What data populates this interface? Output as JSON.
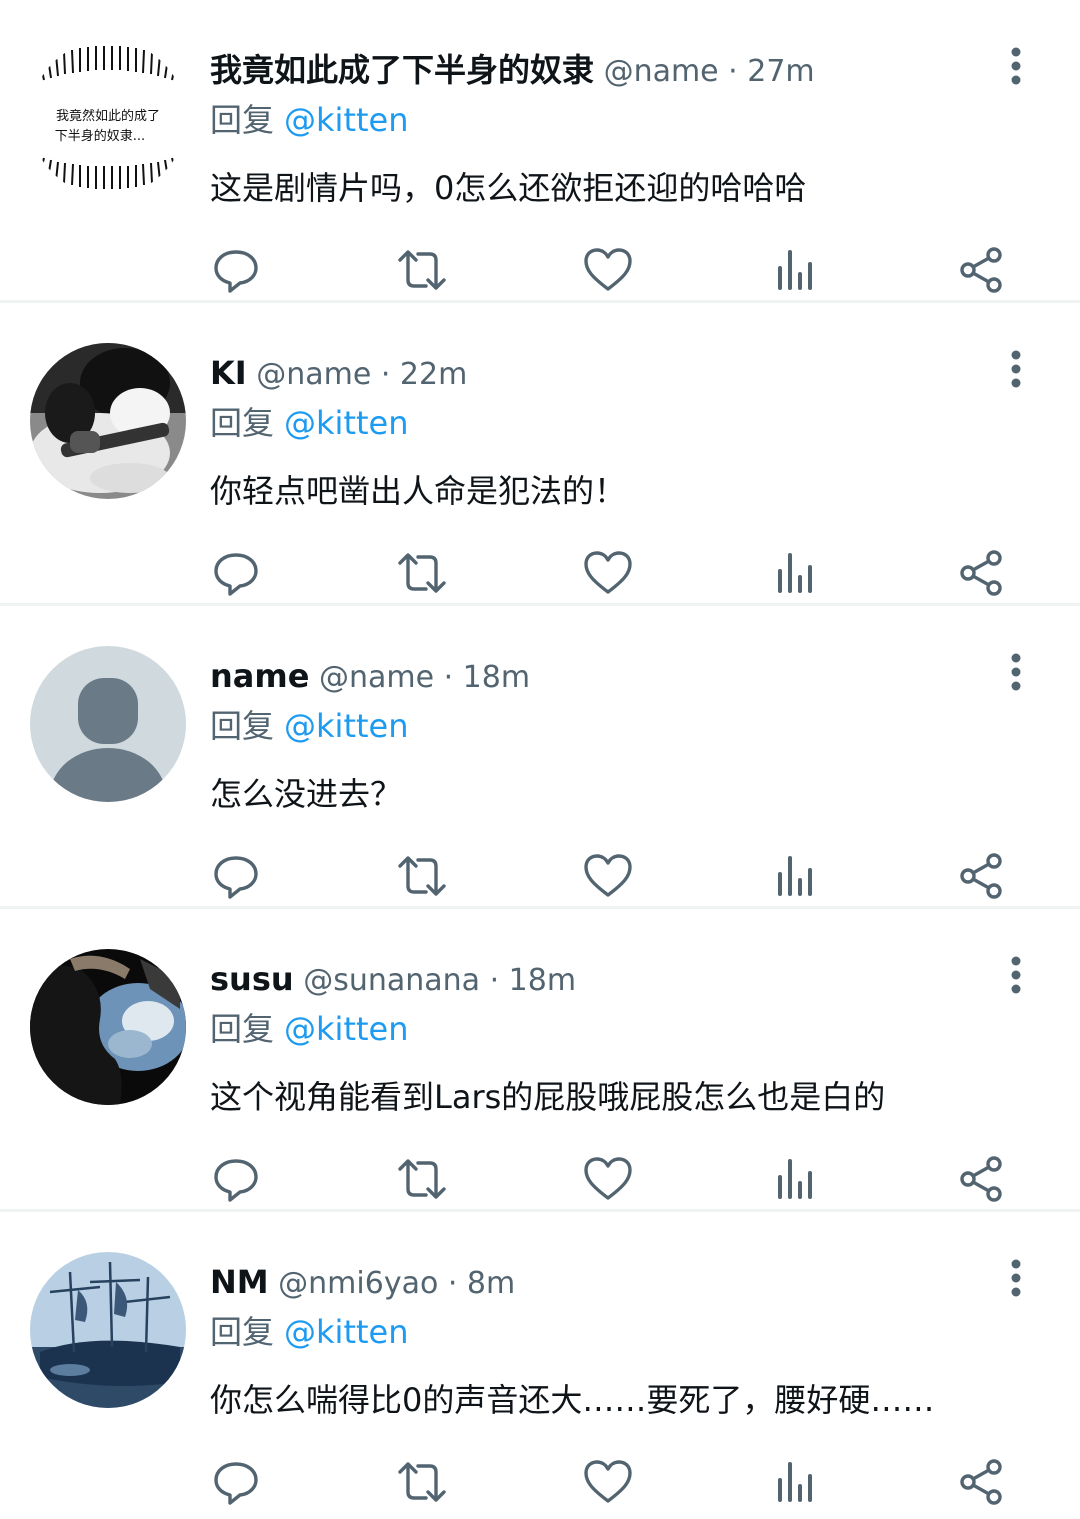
{
  "tweets": [
    {
      "name": "我竟如此成了下半身的奴隶",
      "handle_time": "@name · 27m",
      "reply_prefix": "回复",
      "reply_to": "@kitten",
      "text": "这是剧情片吗，0怎么还欲拒还迎的哈哈哈",
      "avatar_text_line1": "我竟然如此的成了",
      "avatar_text_line2": "下半身的奴隶..."
    },
    {
      "name": "KI",
      "handle_time": "@name · 22m",
      "reply_prefix": "回复",
      "reply_to": "@kitten",
      "text": "你轻点吧凿出人命是犯法的！"
    },
    {
      "name": "name",
      "handle_time": "@name · 18m",
      "reply_prefix": "回复",
      "reply_to": "@kitten",
      "text": "怎么没进去？"
    },
    {
      "name": "susu",
      "handle_time": "@sunanana · 18m",
      "reply_prefix": "回复",
      "reply_to": "@kitten",
      "text": "这个视角能看到Lars的屁股哦屁股怎么也是白的"
    },
    {
      "name": "NM",
      "handle_time": "@nmi6yao · 8m",
      "reply_prefix": "回复",
      "reply_to": "@kitten",
      "text": "你怎么喘得比0的声音还大……要死了，腰好硬……"
    }
  ],
  "colors": {
    "primary_text": "#0f1419",
    "secondary_text": "#536471",
    "accent": "#1d9bf0",
    "divider": "#eff3f4"
  },
  "icons": {
    "actions": [
      "reply-icon",
      "retweet-icon",
      "like-icon",
      "views-icon",
      "share-icon"
    ],
    "more": "more-vertical-icon"
  }
}
